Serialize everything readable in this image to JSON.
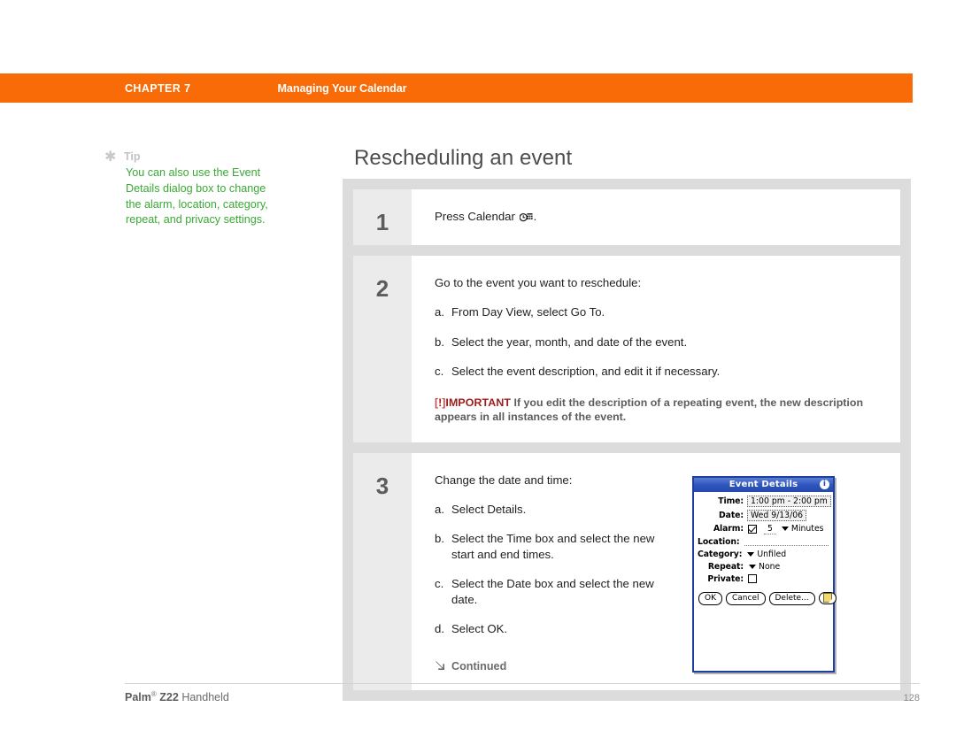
{
  "header": {
    "chapter_label": "CHAPTER 7",
    "section_title": "Managing Your Calendar",
    "accent_color": "#f96b07"
  },
  "tip": {
    "icon": "asterisk-icon",
    "title": "Tip",
    "body": "You can also use the Event Details dialog box to change the alarm, location, category, repeat, and privacy settings.",
    "color": "#3aa935"
  },
  "page": {
    "heading": "Rescheduling an event"
  },
  "steps": [
    {
      "number": "1",
      "lead_before": "Press Calendar",
      "icon": "calendar-button-icon",
      "lead_after": "."
    },
    {
      "number": "2",
      "lead": "Go to the event you want to reschedule:",
      "substeps": [
        {
          "marker": "a.",
          "text": "From Day View, select Go To."
        },
        {
          "marker": "b.",
          "text": "Select the year, month, and date of the event."
        },
        {
          "marker": "c.",
          "text": "Select the event description, and edit it if necessary."
        }
      ],
      "important": {
        "bracket_open": "[",
        "bang": "!",
        "bracket_close": "]",
        "word": "IMPORTANT",
        "text": "If you edit the description of a repeating event, the new description appears in all instances of the event."
      }
    },
    {
      "number": "3",
      "lead": "Change the date and time:",
      "substeps": [
        {
          "marker": "a.",
          "text": "Select Details."
        },
        {
          "marker": "b.",
          "text": "Select the Time box and select the new start and end times."
        },
        {
          "marker": "c.",
          "text": "Select the Date box and select the new date."
        },
        {
          "marker": "d.",
          "text": "Select OK."
        }
      ],
      "continued": {
        "arrow": "arrow-down-right-icon",
        "label": "Continued"
      }
    }
  ],
  "dialog": {
    "title": "Event Details",
    "info_icon": "info-icon",
    "fields": {
      "time_label": "Time:",
      "time_value": "1:00 pm - 2:00 pm",
      "date_label": "Date:",
      "date_value": "Wed 9/13/06",
      "alarm_label": "Alarm:",
      "alarm_checked": true,
      "alarm_amount": "5",
      "alarm_unit": "Minutes",
      "location_label": "Location:",
      "location_value": "",
      "category_label": "Category:",
      "category_value": "Unfiled",
      "repeat_label": "Repeat:",
      "repeat_value": "None",
      "private_label": "Private:",
      "private_checked": false
    },
    "buttons": {
      "ok": "OK",
      "cancel": "Cancel",
      "delete": "Delete...",
      "note_icon": "note-icon"
    },
    "title_bar_color": "#2549ad"
  },
  "footer": {
    "brand": "Palm",
    "registered": "®",
    "model": "Z22",
    "product": "Handheld",
    "page_number": "128"
  }
}
